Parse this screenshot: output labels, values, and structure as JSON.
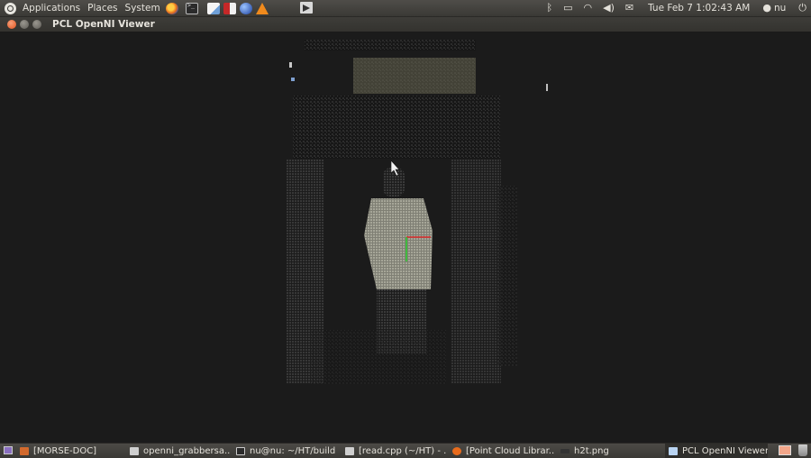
{
  "top_panel": {
    "menus": [
      "Applications",
      "Places",
      "System"
    ],
    "launchers": [
      "firefox-icon",
      "terminal-icon",
      "text-editor-icon",
      "kde-icon",
      "browser-globe-icon",
      "vlc-icon"
    ],
    "center_icon": "media-icon",
    "tray_icons": [
      "bluetooth-icon",
      "battery-icon",
      "wifi-icon",
      "volume-icon",
      "mail-icon"
    ],
    "clock": "Tue Feb  7  1:02:43 AM",
    "user": "nu"
  },
  "window": {
    "title": "PCL OpenNI Viewer"
  },
  "taskbar": {
    "tasks": [
      {
        "label": "[MORSE-DOC]",
        "icon": "folder-icon",
        "color": "#d2692d"
      },
      {
        "label": "openni_grabbersa...",
        "icon": "text-editor-icon",
        "color": "#cfcfcf"
      },
      {
        "label": "nu@nu: ~/HT/build",
        "icon": "terminal-icon",
        "color": "#cfcfcf"
      },
      {
        "label": "[read.cpp (~/HT) - ...",
        "icon": "text-editor-icon",
        "color": "#cfcfcf"
      },
      {
        "label": "[Point Cloud Librar...",
        "icon": "firefox-icon",
        "color": "#e86b1c"
      },
      {
        "label": "h2t.png",
        "icon": "image-icon",
        "color": "#333333"
      },
      {
        "label": "PCL OpenNI Viewer",
        "icon": "window-icon",
        "color": "#b9d4f2"
      }
    ]
  },
  "colors": {
    "panel": "#3a3935",
    "viewer_bg": "#1b1b1b",
    "axis_x": "#d82a2a",
    "axis_y": "#2cc12c"
  }
}
